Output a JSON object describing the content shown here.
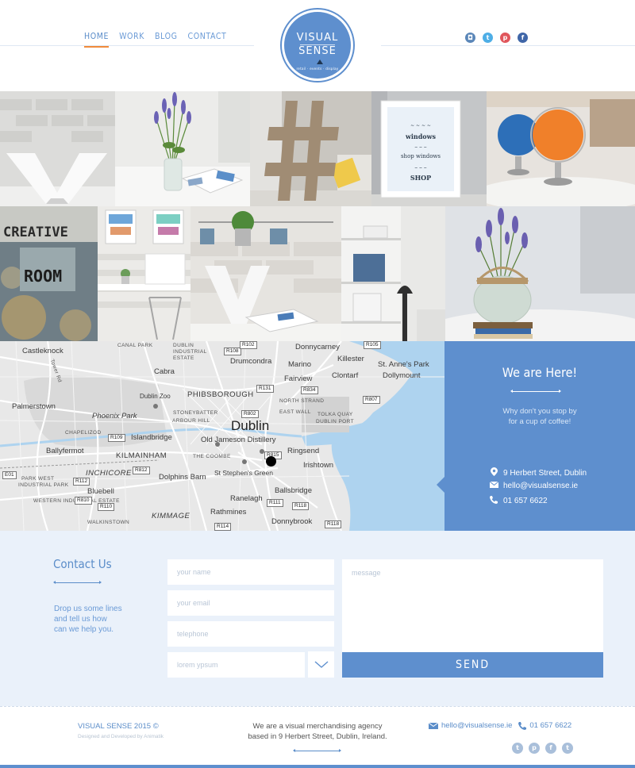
{
  "nav": {
    "items": [
      {
        "label": "HOME",
        "active": true
      },
      {
        "label": "WORK"
      },
      {
        "label": "BLOG"
      },
      {
        "label": "CONTACT"
      }
    ]
  },
  "logo": {
    "line1": "VISUAL",
    "line2": "SENSE",
    "tagline": "retail · events · display"
  },
  "social_icons": [
    "instagram-icon",
    "twitter-icon",
    "pinterest-icon",
    "facebook-icon"
  ],
  "gallery": {
    "tiles": [
      {
        "name": "letter-v-tile"
      },
      {
        "name": "lavender-magazine-tile"
      },
      {
        "name": "hashtag-tile"
      },
      {
        "name": "shop-windows-print-tile"
      },
      {
        "name": "globes-tile"
      },
      {
        "name": "creative-room-tile",
        "text": "CREATIVE ROOM"
      },
      {
        "name": "posters-desk-tile"
      },
      {
        "name": "wall-planters-tile"
      },
      {
        "name": "shelves-lamp-tile"
      },
      {
        "name": "lavender-jar-tile"
      }
    ],
    "print_text": [
      "windows",
      "shop windows",
      "SHOP"
    ]
  },
  "map": {
    "city": "Dublin",
    "labels": {
      "castleknock": "Castleknock",
      "cabra": "Cabra",
      "drumcondra": "Drumcondra",
      "marino": "Marino",
      "donnycarney": "Donnycarney",
      "killester": "Killester",
      "st_annes": "St. Anne's Park",
      "clontarf": "Clontarf",
      "dollymount": "Dollymount",
      "fairview": "Fairview",
      "dublin_zoo": "Dublin Zoo",
      "phibsborough": "PHIBSBOROUGH",
      "palmerstown": "Palmerstown",
      "phoenix_park": "Phoenix Park",
      "islandbridge": "Islandbridge",
      "jameson": "Old Jameson Distillery",
      "ballyfermot": "Ballyfermot",
      "kilmainham": "KILMAINHAM",
      "ringsend": "Ringsend",
      "irishtown": "Irishtown",
      "inchicore": "INCHICORE",
      "dolphins_barn": "Dolphins Barn",
      "st_stephens": "St Stephen's Green",
      "bluebell": "Bluebell",
      "ballsbridge": "Ballsbridge",
      "ranelagh": "Ranelagh",
      "kimmage": "KIMMAGE",
      "rathmines": "Rathmines",
      "donnybrook": "Donnybrook",
      "walkinstown": "WALKINSTOWN",
      "canal_park": "CANAL PARK",
      "dublin_ind_estate": "DUBLIN INDUSTRIAL ESTATE",
      "stoneybatter": "STONEYBATTER",
      "arbour_hill": "ARBOUR HILL",
      "north_strand": "NORTH STRAND",
      "east_wall": "EAST WALL",
      "tolka_quay": "TOLKA QUAY",
      "dublin_port": "DUBLIN PORT",
      "chapelizod": "CHAPELIZOD",
      "the_coombe": "THE COOMBE",
      "park_west": "PARK WEST",
      "park_west_ind": "INDUSTRIAL PARK",
      "western_ind": "WESTERN INDUSTRIAL ESTATE",
      "tower_rd": "Tower Rd"
    },
    "roads": [
      "R102",
      "R108",
      "R105",
      "R131",
      "R834",
      "R802",
      "R807",
      "R109",
      "R812",
      "R815",
      "R112",
      "R810",
      "R110",
      "R111",
      "R114",
      "R118",
      "E01"
    ]
  },
  "here": {
    "title": "We are Here!",
    "sub_line1": "Why don't you stop by",
    "sub_line2": "for a cup of coffee!",
    "address": "9 Herbert Street, Dublin",
    "email": "hello@visualsense.ie",
    "phone": "01 657 6622"
  },
  "contact": {
    "title": "Contact Us",
    "intro_line1": "Drop us some lines",
    "intro_line2": "and tell us how",
    "intro_line3": "can we help you.",
    "name_placeholder": "your name",
    "email_placeholder": "your email",
    "phone_placeholder": "telephone",
    "select_value": "lorem ypsum",
    "message_placeholder": "message",
    "send_label": "SEND"
  },
  "footer": {
    "brand": "VISUAL SENSE 2015 ©",
    "credit": "Designed and Developed by Animatik",
    "about_line1": "We are a visual merchandising agency",
    "about_line2": "based in 9 Herbert Street, Dublin, Ireland.",
    "email": "hello@visualsense.ie",
    "phone": "01 657 6622"
  },
  "colors": {
    "accent": "#5e8fce",
    "nav_active_underline": "#f08b3b",
    "contact_bg": "#eaf1fa"
  }
}
